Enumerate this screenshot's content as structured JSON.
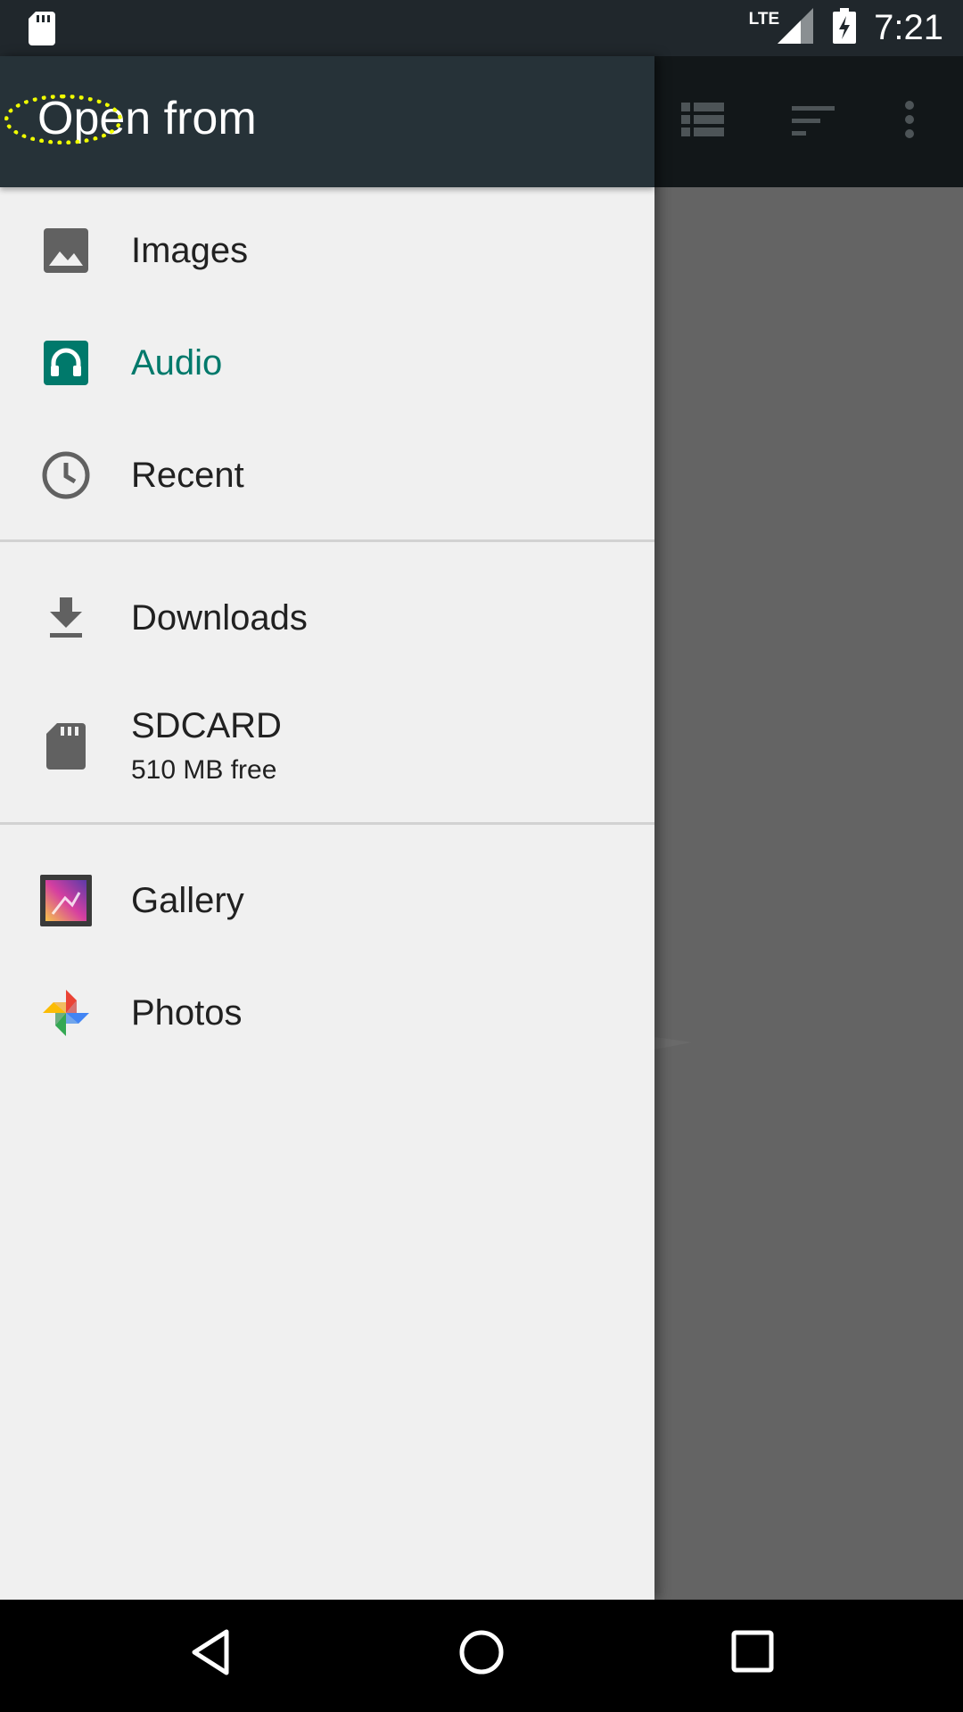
{
  "status_bar": {
    "network": "LTE",
    "time": "7:21",
    "icons": [
      "sd-card-icon",
      "signal-icon",
      "battery-charging-icon"
    ]
  },
  "toolbar": {
    "icons": [
      "list-view-icon",
      "sort-icon",
      "overflow-menu-icon"
    ]
  },
  "drawer": {
    "title": "Open from",
    "sections": [
      {
        "items": [
          {
            "label": "Images",
            "icon": "image-icon",
            "active": false
          },
          {
            "label": "Audio",
            "icon": "headphones-icon",
            "active": true
          },
          {
            "label": "Recent",
            "icon": "clock-icon",
            "active": false
          }
        ]
      },
      {
        "items": [
          {
            "label": "Downloads",
            "icon": "download-icon",
            "active": false
          },
          {
            "label": "SDCARD",
            "sublabel": "510 MB free",
            "icon": "sd-card-icon",
            "active": false
          }
        ]
      },
      {
        "items": [
          {
            "label": "Gallery",
            "icon": "gallery-app-icon",
            "active": false
          },
          {
            "label": "Photos",
            "icon": "photos-app-icon",
            "active": false
          }
        ]
      }
    ]
  },
  "nav_bar": {
    "buttons": [
      "back-icon",
      "home-icon",
      "recents-icon"
    ]
  },
  "colors": {
    "accent": "#00796b",
    "drawer_header": "#263238",
    "drawer_bg": "#f0f0f0",
    "scrim": "#646464",
    "focus_ring": "#f1ff00"
  }
}
